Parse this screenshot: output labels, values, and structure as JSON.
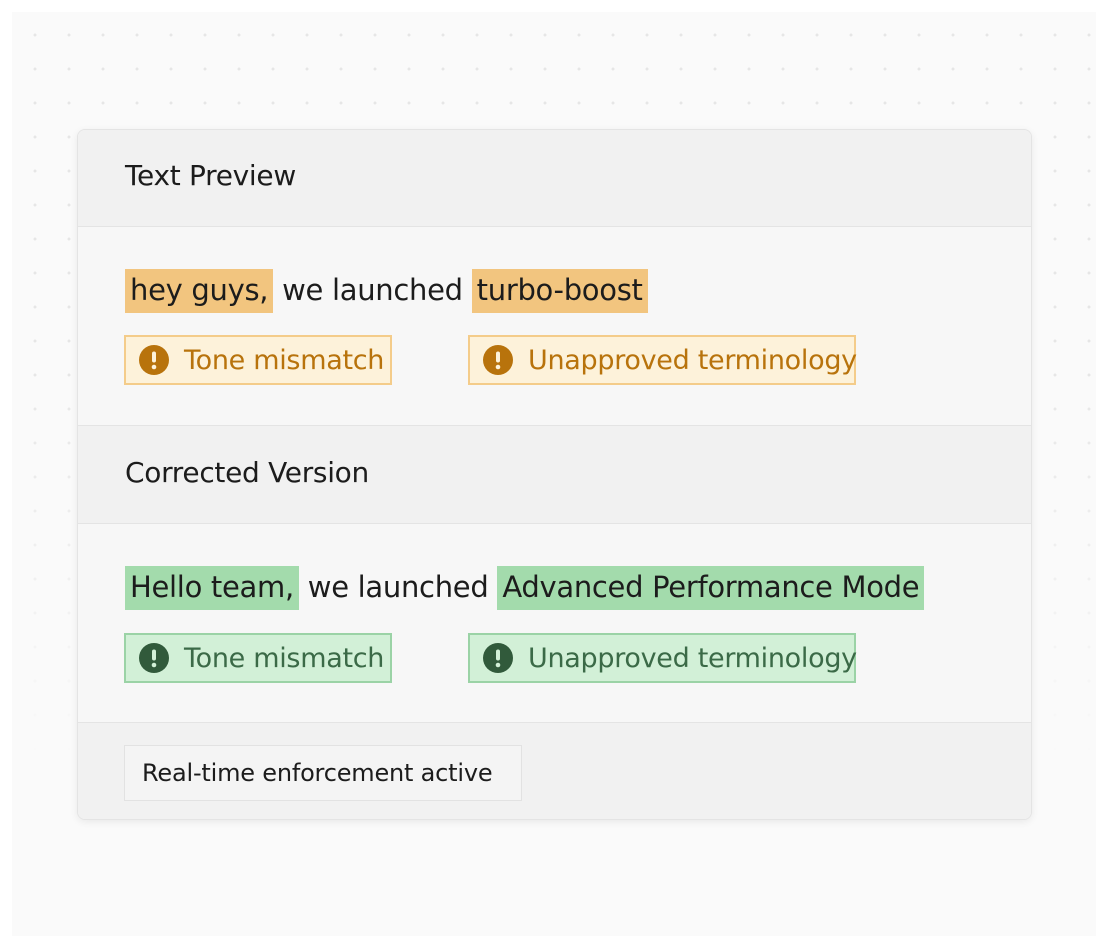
{
  "preview": {
    "title": "Text Preview",
    "segments": {
      "flag1": "hey guys,",
      "plain": " we launched ",
      "flag2": "turbo-boost"
    },
    "badges": {
      "tone": "Tone mismatch",
      "terminology": "Unapproved terminology"
    }
  },
  "corrected": {
    "title": "Corrected Version",
    "segments": {
      "fix1": "Hello team,",
      "plain": " we launched ",
      "fix2": "Advanced Performance Mode"
    },
    "badges": {
      "tone": "Tone mismatch",
      "terminology": "Unapproved terminology"
    }
  },
  "footer": {
    "status": "Real-time enforcement active"
  },
  "colors": {
    "flag_highlight": "#f2c57f",
    "fix_highlight": "#a3dbac",
    "warning_text": "#b8730c",
    "success_text": "#3b6a47"
  },
  "icons": {
    "warning": "exclamation-circle-icon",
    "success": "exclamation-circle-icon"
  }
}
